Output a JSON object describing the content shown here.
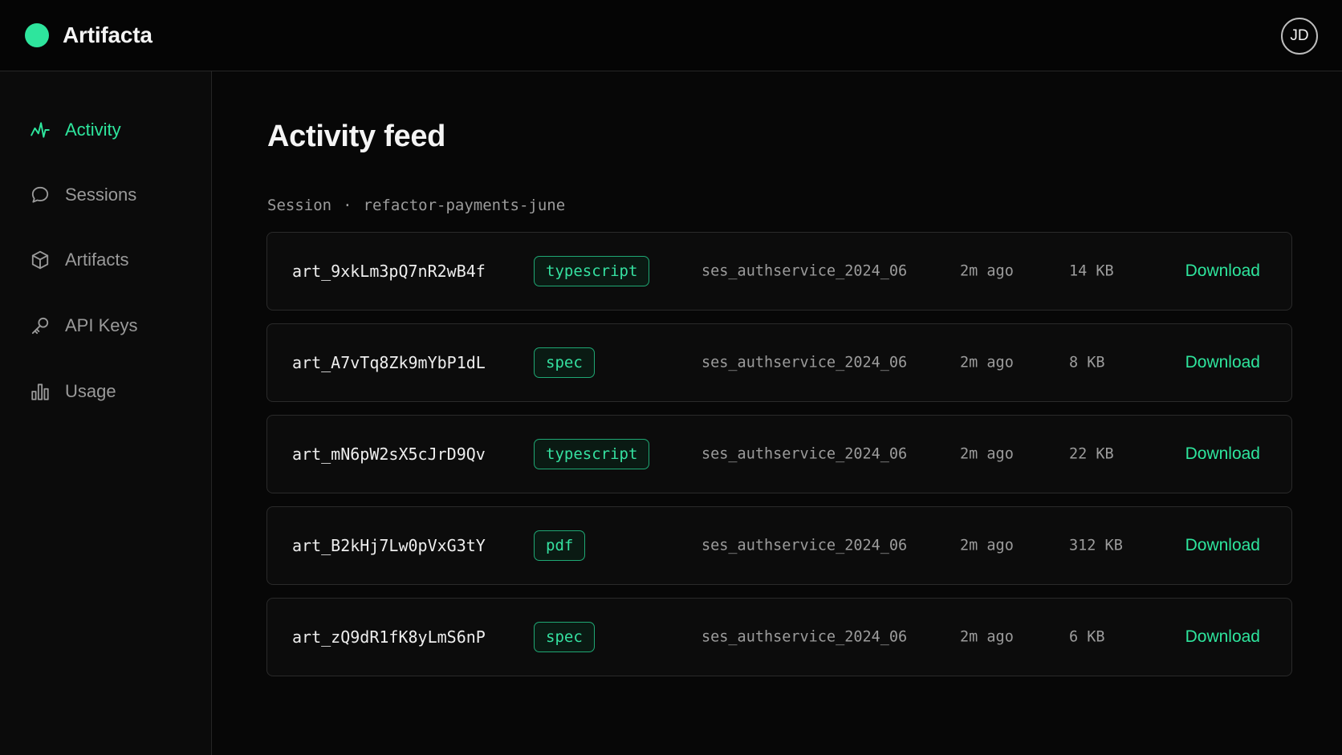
{
  "app": {
    "name": "Artifacta",
    "brand_color": "#2ee59d",
    "user_initials": "JD"
  },
  "sidebar": {
    "items": [
      {
        "label": "Activity",
        "icon": "activity-icon",
        "active": true
      },
      {
        "label": "Sessions",
        "icon": "chat-bubble-icon",
        "active": false
      },
      {
        "label": "Artifacts",
        "icon": "cube-icon",
        "active": false
      },
      {
        "label": "API Keys",
        "icon": "key-icon",
        "active": false
      },
      {
        "label": "Usage",
        "icon": "bar-chart-icon",
        "active": false
      }
    ]
  },
  "main": {
    "title": "Activity feed",
    "session_prefix": "Session",
    "session_separator": "·",
    "session_name": "refactor-payments-june",
    "rows": [
      {
        "id": "art_9xkLm3pQ7nR2wB4f",
        "type": "typescript",
        "session": "ses_authservice_2024_06",
        "time": "2m ago",
        "size": "14 KB",
        "action": "Download"
      },
      {
        "id": "art_A7vTq8Zk9mYbP1dL",
        "type": "spec",
        "session": "ses_authservice_2024_06",
        "time": "2m ago",
        "size": "8 KB",
        "action": "Download"
      },
      {
        "id": "art_mN6pW2sX5cJrD9Qv",
        "type": "typescript",
        "session": "ses_authservice_2024_06",
        "time": "2m ago",
        "size": "22 KB",
        "action": "Download"
      },
      {
        "id": "art_B2kHj7Lw0pVxG3tY",
        "type": "pdf",
        "session": "ses_authservice_2024_06",
        "time": "2m ago",
        "size": "312 KB",
        "action": "Download"
      },
      {
        "id": "art_zQ9dR1fK8yLmS6nP",
        "type": "spec",
        "session": "ses_authservice_2024_06",
        "time": "2m ago",
        "size": "6 KB",
        "action": "Download"
      }
    ]
  }
}
